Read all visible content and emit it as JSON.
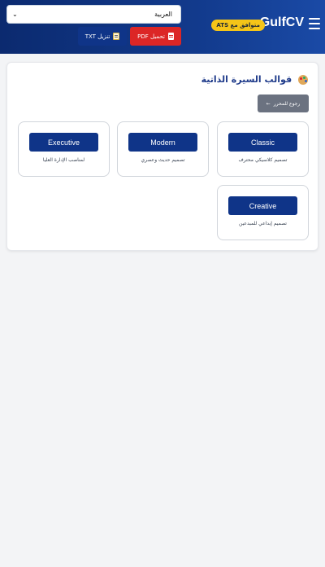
{
  "header": {
    "brand": "GulfCV",
    "ats_badge": "متوافق مع ATS",
    "language_select": {
      "value": "العربية",
      "options": [
        "العربية"
      ]
    },
    "download_pdf_label": "تحميل PDF",
    "download_txt_label": "تنزيل TXT"
  },
  "panel": {
    "title": "قوالب السيرة الذاتية",
    "back_label": "رجوع للمحرر",
    "templates": [
      {
        "name": "Classic",
        "description": "تصميم كلاسيكي محترف"
      },
      {
        "name": "Modern",
        "description": "تصميم حديث وعصري"
      },
      {
        "name": "Executive",
        "description": "لمناصب الإدارة العليا"
      },
      {
        "name": "Creative",
        "description": "تصميم إبداعي للمبدعين"
      }
    ]
  },
  "colors": {
    "header_bg": "#0b2a6f",
    "primary": "#0f3488",
    "pdf_red": "#dc2626",
    "badge_yellow": "#f5c518",
    "back_gray": "#6b7280"
  },
  "icons": {
    "menu": "hamburger-icon",
    "pdf": "document-icon",
    "txt": "memo-icon",
    "title": "palette-icon",
    "back": "arrow-left-icon"
  }
}
